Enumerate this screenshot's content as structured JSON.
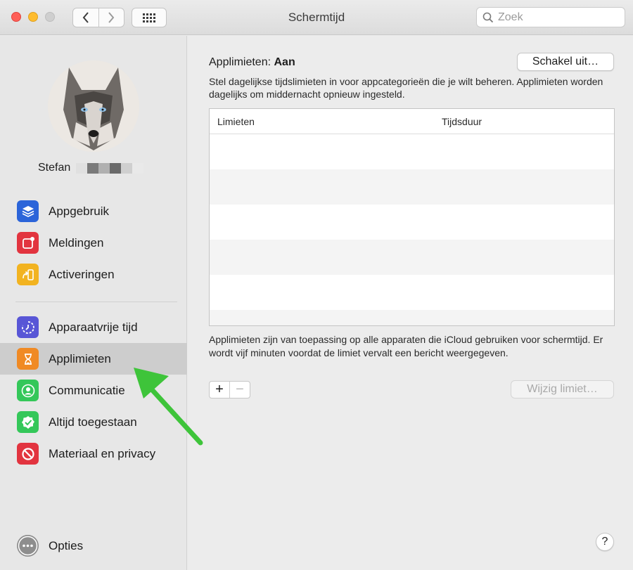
{
  "window": {
    "title": "Schermtijd"
  },
  "toolbar": {
    "search_placeholder": "Zoek"
  },
  "sidebar": {
    "user_name": "Stefan",
    "items": [
      {
        "label": "Appgebruik",
        "icon": "layers-icon",
        "color": "#2b64d9"
      },
      {
        "label": "Meldingen",
        "icon": "notification-icon",
        "color": "#e2343f"
      },
      {
        "label": "Activeringen",
        "icon": "pickup-icon",
        "color": "#f2b320"
      },
      {
        "label": "Apparaatvrije tijd",
        "icon": "downtime-icon",
        "color": "#5856d6"
      },
      {
        "label": "Applimieten",
        "icon": "hourglass-icon",
        "color": "#f08a24",
        "selected": true
      },
      {
        "label": "Communicatie",
        "icon": "contact-icon",
        "color": "#34c759"
      },
      {
        "label": "Altijd toegestaan",
        "icon": "checkmark-badge-icon",
        "color": "#34c759"
      },
      {
        "label": "Materiaal en privacy",
        "icon": "restriction-icon",
        "color": "#e2343f"
      }
    ],
    "options_label": "Opties"
  },
  "main": {
    "heading_label": "Applimieten:",
    "heading_status": "Aan",
    "turn_off_button": "Schakel uit…",
    "description": "Stel dagelijkse tijdslimieten in voor appcategorieën die je wilt beheren. Applimieten worden dagelijks om middernacht opnieuw ingesteld.",
    "table": {
      "columns": [
        "Limieten",
        "Tijdsduur"
      ],
      "rows": []
    },
    "note": "Applimieten zijn van toepassing op alle apparaten die iCloud gebruiken voor schermtijd. Er wordt vijf minuten voordat de limiet vervalt een bericht weergegeven.",
    "add_symbol": "+",
    "remove_symbol": "−",
    "edit_button": "Wijzig limiet…",
    "help_symbol": "?"
  },
  "annotation": {
    "arrow_color": "#3ec43a"
  }
}
